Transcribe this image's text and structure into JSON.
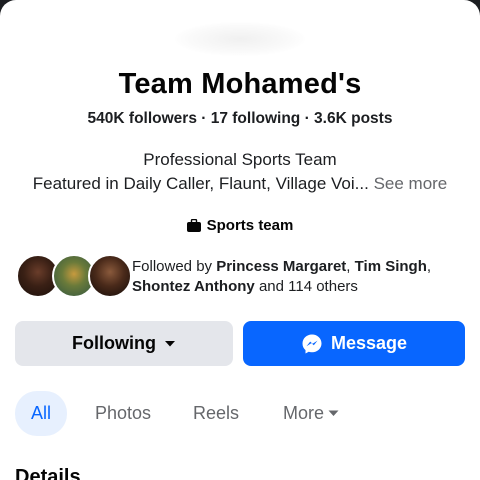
{
  "page": {
    "name": "Team Mohamed's",
    "stats": "540K followers · 17 following · 3.6K posts",
    "description_line1": "Professional Sports Team",
    "description_line2": "Featured in Daily Caller, Flaunt, Village Voi...",
    "see_more": "See more",
    "category_icon": "briefcase-icon",
    "category": "Sports team"
  },
  "followed_by": {
    "prefix": "Followed by",
    "names": [
      "Princess Margaret",
      "Tim Singh",
      "Shontez Anthony"
    ],
    "sep1": ",",
    "sep2": ",",
    "suffix": "and 114 others"
  },
  "actions": {
    "following_label": "Following",
    "following_icon": "caret-down-icon",
    "message_label": "Message",
    "message_icon": "messenger-icon",
    "message_color": "#0866ff"
  },
  "tabs": [
    {
      "label": "All",
      "active": true
    },
    {
      "label": "Photos",
      "active": false
    },
    {
      "label": "Reels",
      "active": false
    },
    {
      "label": "More",
      "active": false
    }
  ],
  "section_heading": "Details"
}
